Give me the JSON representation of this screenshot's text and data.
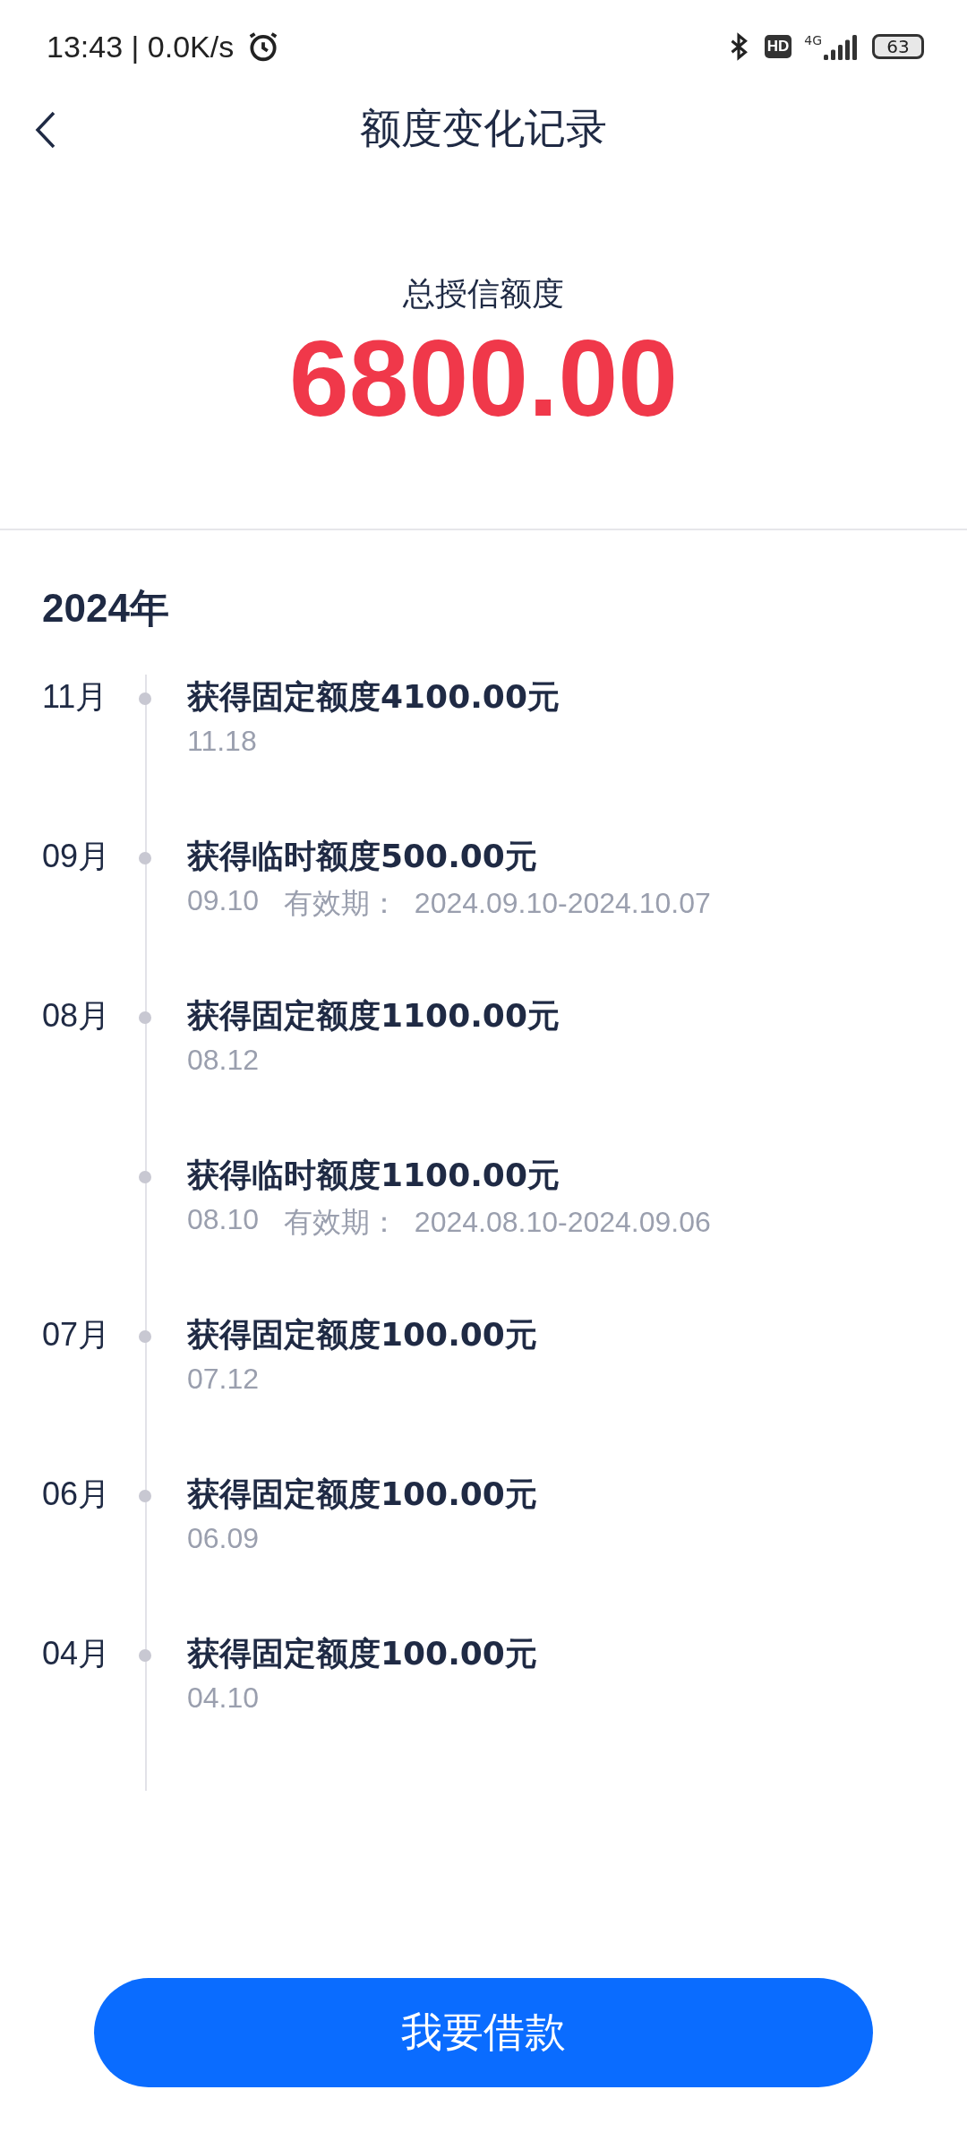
{
  "status_bar": {
    "time": "13:43",
    "separator": "|",
    "speed": "0.0K/s",
    "hd": "HD",
    "network": "4G",
    "battery": "63"
  },
  "header": {
    "title": "额度变化记录"
  },
  "summary": {
    "label": "总授信额度",
    "amount": "6800.00"
  },
  "year": "2024年",
  "records": [
    {
      "month": "11月",
      "title": "获得固定额度4100.00元",
      "date": "11.18"
    },
    {
      "month": "09月",
      "title": "获得临时额度500.00元",
      "date": "09.10",
      "validity": "有效期：  2024.09.10-2024.10.07"
    },
    {
      "month": "08月",
      "title": "获得固定额度1100.00元",
      "date": "08.12"
    },
    {
      "title": "获得临时额度1100.00元",
      "date": "08.10",
      "validity": "有效期：  2024.08.10-2024.09.06"
    },
    {
      "month": "07月",
      "title": "获得固定额度100.00元",
      "date": "07.12"
    },
    {
      "month": "06月",
      "title": "获得固定额度100.00元",
      "date": "06.09"
    },
    {
      "month": "04月",
      "title": "获得固定额度100.00元",
      "date": "04.10"
    }
  ],
  "button": {
    "label": "我要借款"
  }
}
